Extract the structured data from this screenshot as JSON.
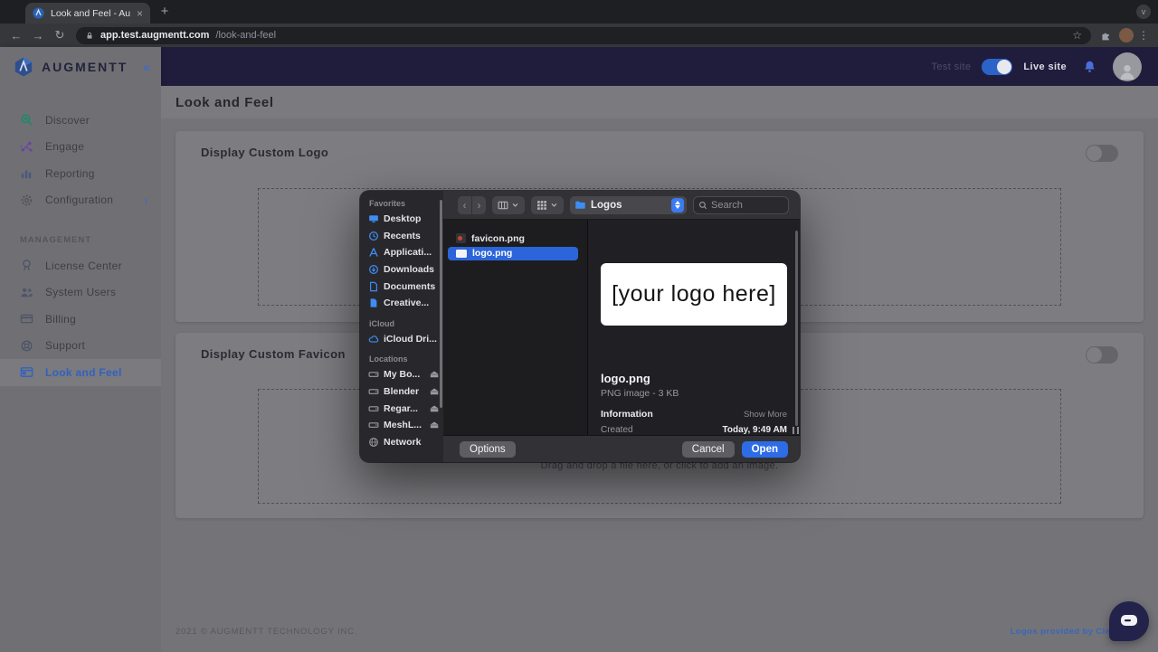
{
  "browser": {
    "tab_title": "Look and Feel - Augmentt",
    "url_domain": "app.test.augmentt.com",
    "url_path": "/look-and-feel"
  },
  "glyphs": {
    "close": "×",
    "plus": "+",
    "tab_caret": "v",
    "back": "←",
    "forward": "→",
    "refresh": "↻",
    "star": "☆",
    "dots": "⋮",
    "collapse": "«",
    "chevron_right": "›",
    "dlg_back": "‹",
    "dlg_forward": "›",
    "eject": "⏏"
  },
  "header": {
    "brand": "AUGMENTT",
    "test_site": "Test site",
    "live_site": "Live site"
  },
  "nav": {
    "items": [
      {
        "label": "Discover"
      },
      {
        "label": "Engage"
      },
      {
        "label": "Reporting"
      },
      {
        "label": "Configuration"
      }
    ],
    "section_title": "MANAGEMENT",
    "management": [
      {
        "label": "License Center"
      },
      {
        "label": "System Users"
      },
      {
        "label": "Billing"
      },
      {
        "label": "Support"
      },
      {
        "label": "Look and Feel"
      }
    ]
  },
  "page": {
    "title": "Look and Feel",
    "logo_card_heading": "Display Custom Logo",
    "favicon_card_heading": "Display Custom Favicon",
    "dropzone_text": "Drag and drop a file here, or click to add an image.",
    "copyright": "2021 © AUGMENTT TECHNOLOGY INC.",
    "logos_credit": "Logos provided by Clearbit"
  },
  "dialog": {
    "toolbar": {
      "folder": "Logos",
      "search_placeholder": "Search"
    },
    "sidebar": {
      "favorites_title": "Favorites",
      "favorites": [
        "Desktop",
        "Recents",
        "Applicati...",
        "Downloads",
        "Documents",
        "Creative..."
      ],
      "icloud_title": "iCloud",
      "icloud": [
        "iCloud Dri..."
      ],
      "locations_title": "Locations",
      "locations": [
        "My Bo...",
        "Blender",
        "Regar...",
        "MeshL...",
        "Network"
      ]
    },
    "files": [
      {
        "name": "favicon.png"
      },
      {
        "name": "logo.png"
      }
    ],
    "preview": {
      "logo_text": "[your logo here]",
      "file_name": "logo.png",
      "file_meta": "PNG image - 3 KB",
      "information_label": "Information",
      "show_more": "Show More",
      "created_label": "Created",
      "created_value": "Today, 9:49 AM"
    },
    "buttons": {
      "options": "Options",
      "cancel": "Cancel",
      "open": "Open"
    }
  }
}
